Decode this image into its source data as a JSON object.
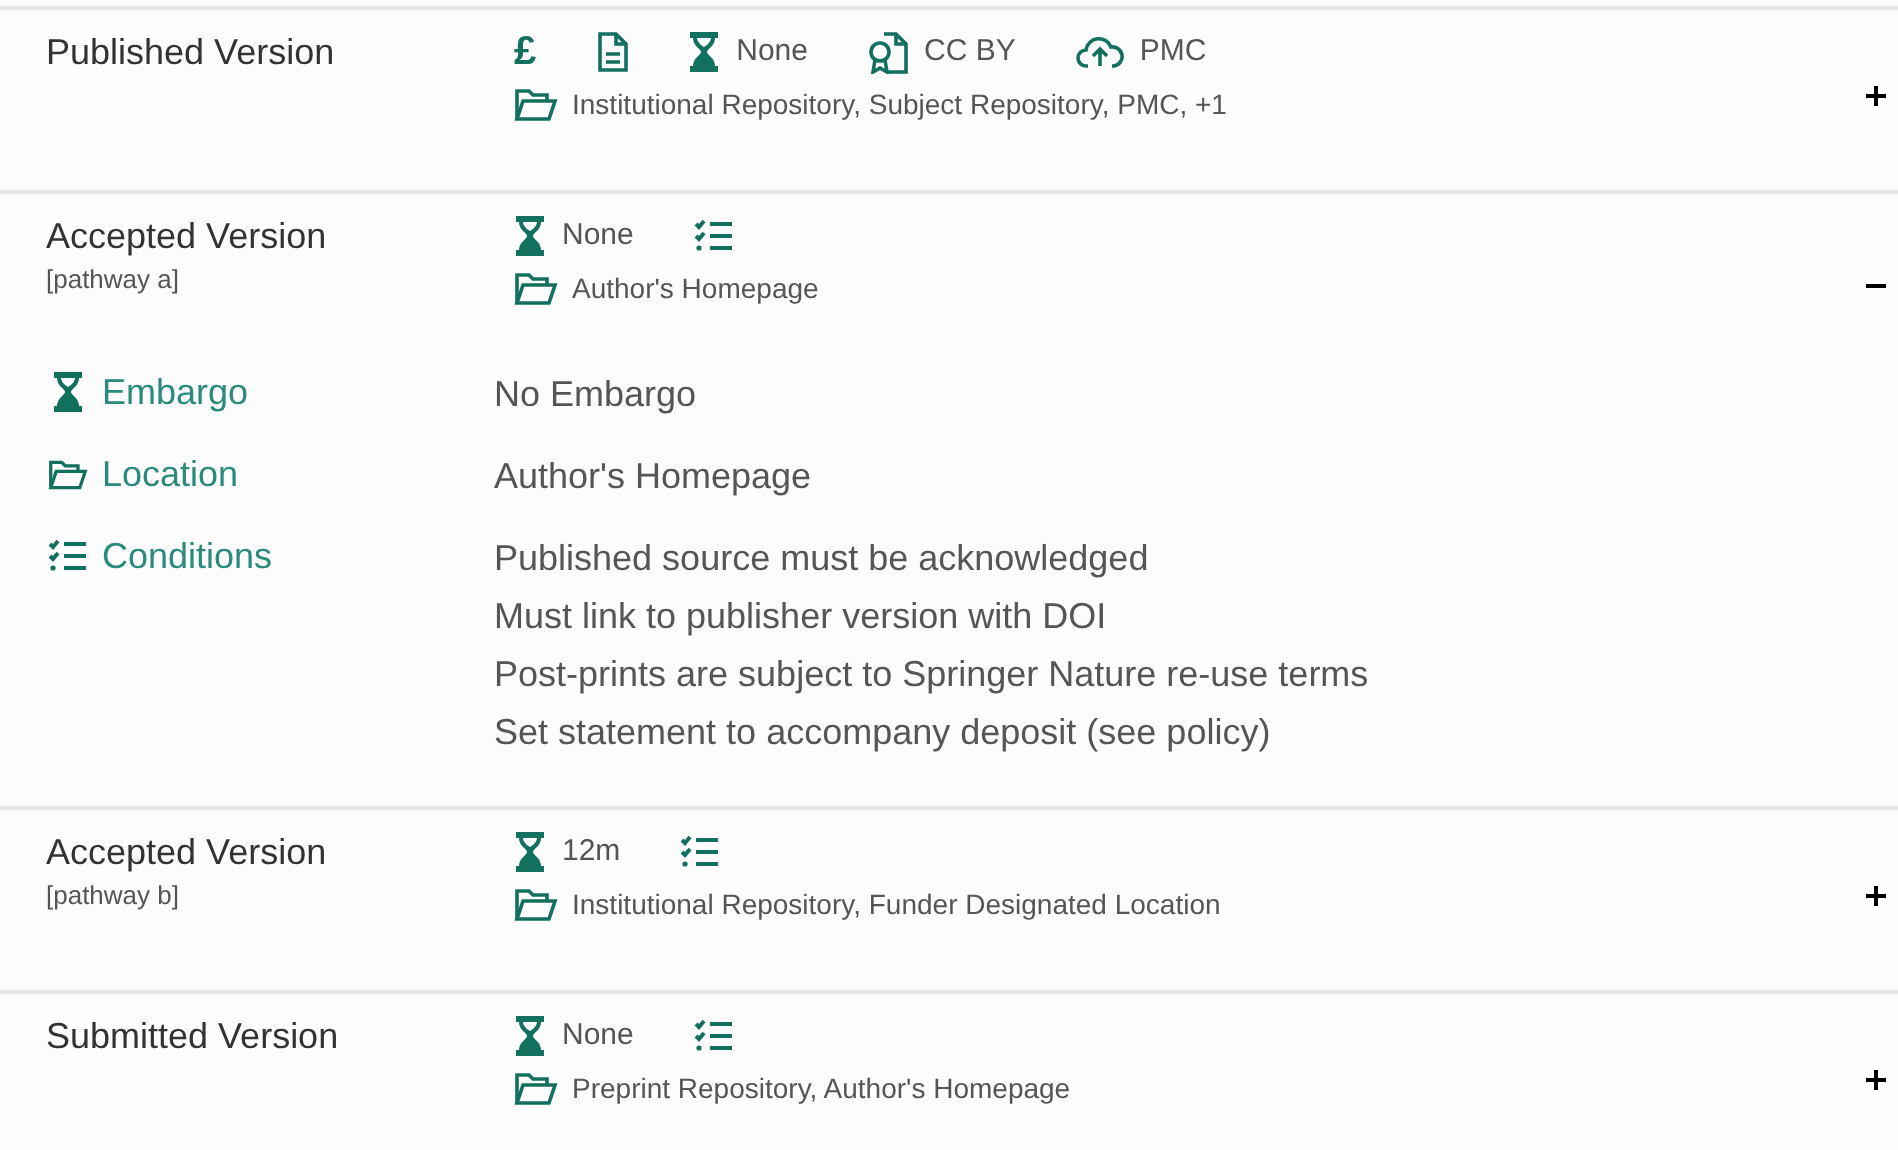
{
  "pathways": [
    {
      "title": "Published Version",
      "expanded": false,
      "summary": [
        {
          "kind": "fee",
          "symbol": "£"
        },
        {
          "kind": "document"
        },
        {
          "kind": "embargo",
          "text": "None"
        },
        {
          "kind": "license",
          "text": "CC BY"
        },
        {
          "kind": "deposit",
          "text": "PMC"
        }
      ],
      "location": "Institutional Repository, Subject Repository, PMC, +1"
    },
    {
      "title": "Accepted Version",
      "subtitle": "[pathway a]",
      "expanded": true,
      "summary": [
        {
          "kind": "embargo",
          "text": "None"
        },
        {
          "kind": "conditions"
        }
      ],
      "location": "Author's Homepage",
      "details": [
        {
          "kind": "embargo",
          "label": "Embargo",
          "values": [
            "No Embargo"
          ]
        },
        {
          "kind": "location",
          "label": "Location",
          "values": [
            "Author's Homepage"
          ]
        },
        {
          "kind": "conditions",
          "label": "Conditions",
          "values": [
            "Published source must be acknowledged",
            "Must link to publisher version with DOI",
            "Post-prints are subject to Springer Nature re-use terms",
            "Set statement to accompany deposit (see policy)"
          ]
        }
      ]
    },
    {
      "title": "Accepted Version",
      "subtitle": "[pathway b]",
      "expanded": false,
      "summary": [
        {
          "kind": "embargo",
          "text": "12m"
        },
        {
          "kind": "conditions"
        }
      ],
      "location": "Institutional Repository, Funder Designated Location"
    },
    {
      "title": "Submitted Version",
      "expanded": false,
      "summary": [
        {
          "kind": "embargo",
          "text": "None"
        },
        {
          "kind": "conditions"
        }
      ],
      "location": "Preprint Repository, Author's Homepage"
    }
  ]
}
